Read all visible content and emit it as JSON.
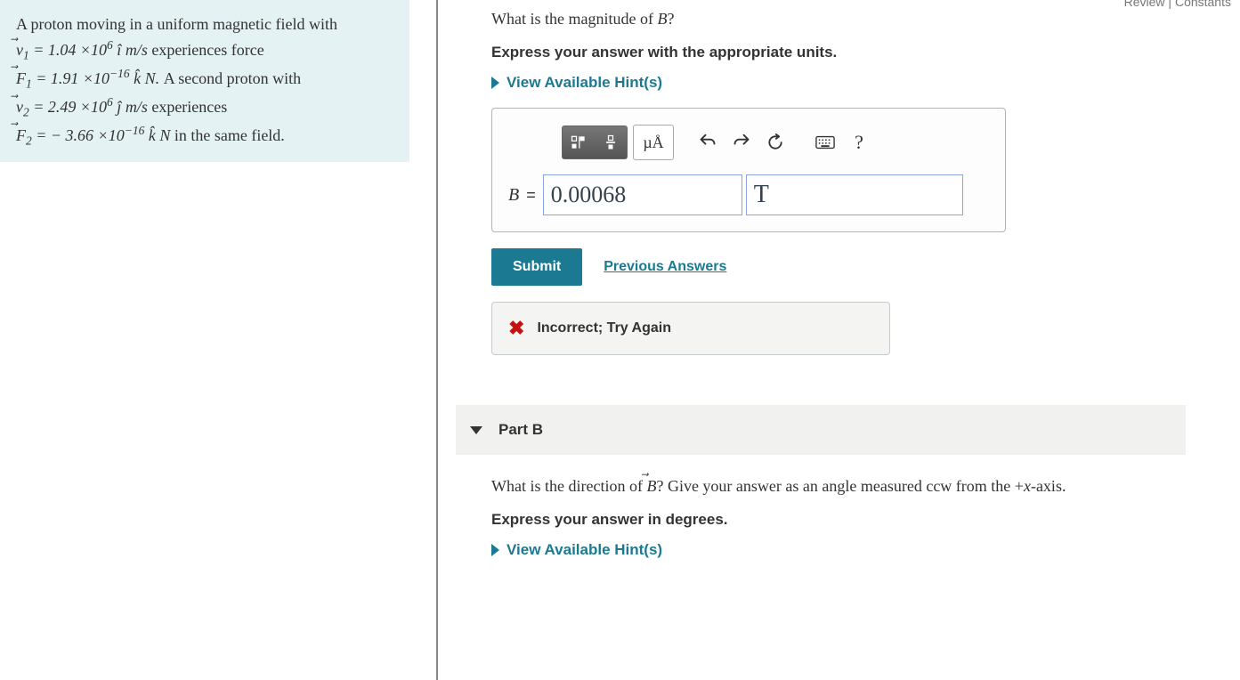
{
  "top_nav": {
    "review": "Review",
    "constants": "Constants"
  },
  "problem": {
    "line1a": "A proton moving in a uniform magnetic field with",
    "v1_lhs": "v⃗₁ = 1.04 ×10",
    "v1_exp": "6",
    "v1_rhs": " î m/s experiences force",
    "f1_lhs": "F⃗₁ = 1.91 ×10",
    "f1_exp": "−16",
    "f1_rhs": " k̂ N. A second proton with",
    "v2_lhs": "v⃗₂ = 2.49 ×10",
    "v2_exp": "6",
    "v2_rhs": " ĵ m/s experiences",
    "f2_lhs": "F⃗₂ = − 3.66 ×10",
    "f2_exp": "−16",
    "f2_rhs": " k̂ N in the same field."
  },
  "partA": {
    "question_pre": "What is the magnitude of ",
    "question_var": "B",
    "question_post": "?",
    "instruction": "Express your answer with the appropriate units.",
    "hints_label": "View Available Hint(s)",
    "unit_tool_label": "µÅ",
    "help_label": "?",
    "input_label": "B",
    "equals": "=",
    "value": "0.00068",
    "unit": "T",
    "submit": "Submit",
    "previous": "Previous Answers",
    "feedback": "Incorrect; Try Again"
  },
  "partB": {
    "header": "Part B",
    "question": "What is the direction of B⃗? Give your answer as an angle measured ccw from the +x-axis.",
    "instruction": "Express your answer in degrees.",
    "hints_label": "View Available Hint(s)"
  }
}
